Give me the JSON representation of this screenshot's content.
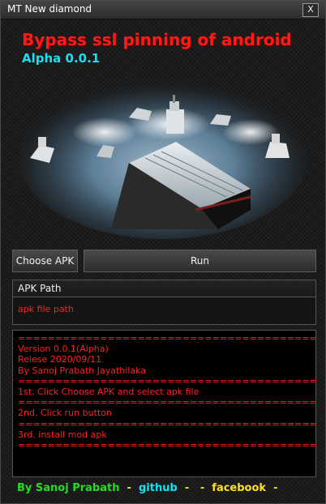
{
  "window": {
    "title": "MT New diamond",
    "close_label": "X"
  },
  "header": {
    "title": "Bypass ssl pinning of android",
    "version": "Alpha 0.0.1"
  },
  "buttons": {
    "choose_apk": "Choose APK",
    "run": "Run"
  },
  "apk_panel": {
    "label": "APK Path",
    "value": "apk file path"
  },
  "console": {
    "lines": [
      "=========================================",
      "Version 0.0.1(Alpha)",
      "Relese 2020/09/11",
      "By Sanoj Prabath Jayathilaka",
      "=========================================",
      "1st. Click Choose APK and select apk file",
      "=========================================",
      "2nd. Click run button",
      "=========================================",
      "3rd. install mod apk",
      "========================================="
    ]
  },
  "footer": {
    "author": "By Sanoj Prabath",
    "sep1": " - ",
    "github": "github",
    "sep2": " - ",
    "sep3": " - ",
    "facebook": "facebook",
    "sep4": " -"
  },
  "colors": {
    "title_red": "#ff1a1a",
    "version_cyan": "#19e0f0",
    "console_red": "#ff2020",
    "author_green": "#22dd22",
    "facebook_yellow": "#ffe020"
  },
  "icons": {
    "hero_image": "ship-firefighting-image",
    "close": "close-icon"
  }
}
